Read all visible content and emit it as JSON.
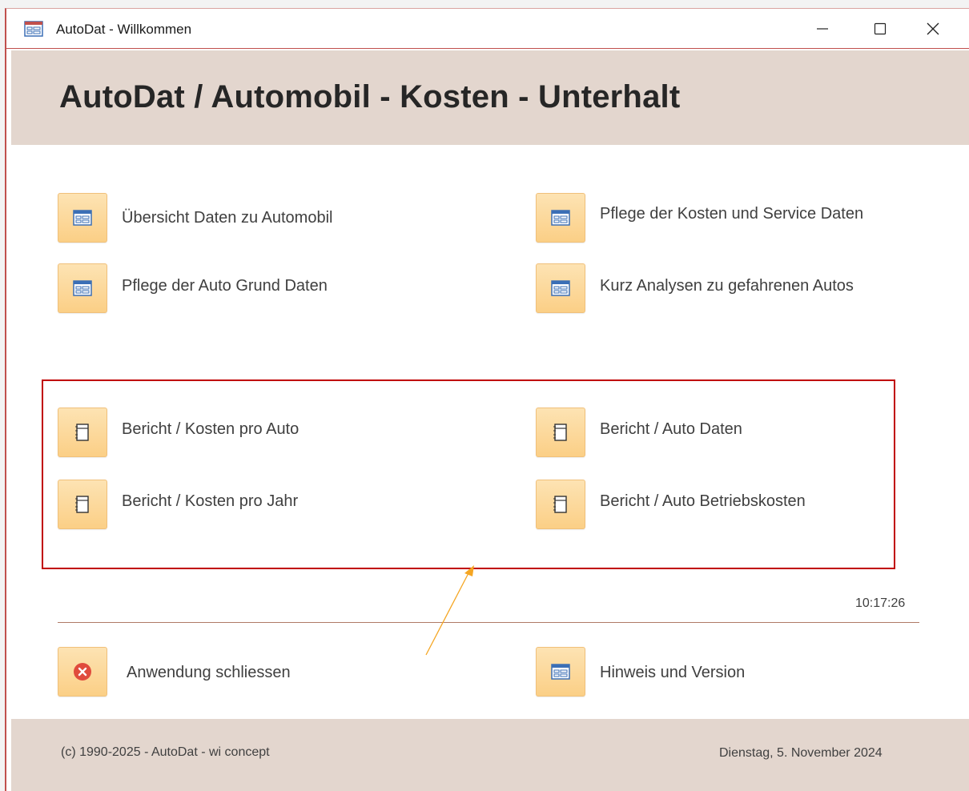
{
  "window": {
    "title": "AutoDat - Willkommen",
    "controls": {
      "minimize": "minimize-icon",
      "maximize": "maximize-icon",
      "close": "close-icon"
    }
  },
  "header": {
    "title": "AutoDat / Automobil - Kosten - Unterhalt"
  },
  "forms": [
    {
      "label": "Übersicht Daten zu Automobil",
      "icon": "form-icon"
    },
    {
      "label": "Pflege der Kosten und Service Daten",
      "icon": "form-icon"
    },
    {
      "label": "Pflege der Auto Grund Daten",
      "icon": "form-icon"
    },
    {
      "label": "Kurz Analysen zu gefahrenen Autos",
      "icon": "form-icon"
    }
  ],
  "reports": [
    {
      "label": "Bericht / Kosten pro Auto",
      "icon": "report-icon"
    },
    {
      "label": "Bericht / Auto Daten",
      "icon": "report-icon"
    },
    {
      "label": "Bericht / Kosten pro Jahr",
      "icon": "report-icon"
    },
    {
      "label": "Bericht / Auto Betriebskosten",
      "icon": "report-icon"
    }
  ],
  "clock": "10:17:26",
  "actions": [
    {
      "label": "Anwendung schliessen",
      "icon": "close-circle-icon"
    },
    {
      "label": "Hinweis und Version",
      "icon": "form-icon"
    }
  ],
  "footer": {
    "copyright": "(c) 1990-2025 - AutoDat - wi concept",
    "date": "Dienstag, 5. November 2024"
  },
  "colors": {
    "accent_red": "#c00000",
    "band": "#e3d6ce",
    "button_fill": "#fbcf86",
    "arrow": "#f5a623"
  }
}
